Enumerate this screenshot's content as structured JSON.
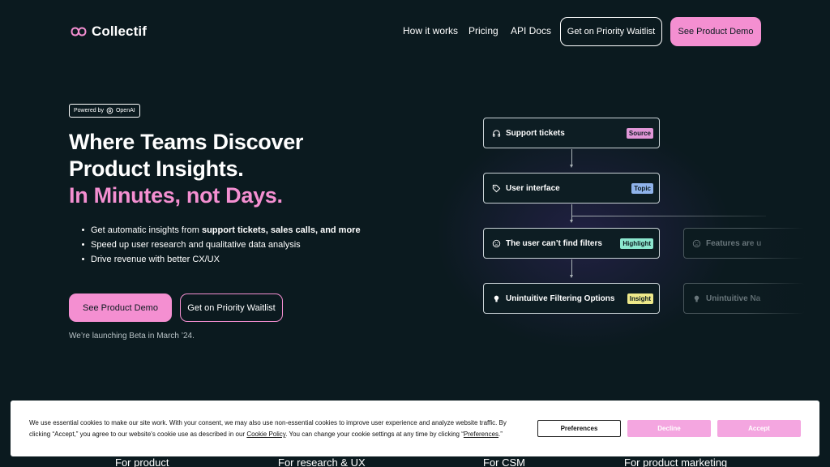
{
  "nav": {
    "logo_text": "Collectif",
    "links": [
      "How it works",
      "Pricing",
      "API Docs"
    ],
    "waitlist_label": "Get on Priority Waitlist",
    "demo_label": "See Product Demo"
  },
  "hero": {
    "badge_prefix": "Powered by",
    "badge_brand": "OpenAI",
    "title_line1": "Where Teams Discover",
    "title_line2": "Product Insights.",
    "title_line3": "In Minutes, not Days.",
    "bullet1_plain": "Get automatic insights from ",
    "bullet1_bold": "support tickets, sales calls, and more",
    "bullet2": "Speed up user research and qualitative data analysis",
    "bullet3": "Drive revenue with better CX/UX",
    "demo_label": "See Product Demo",
    "waitlist_label": "Get on Priority Waitlist",
    "launch_note": "We’re launching Beta in March ’24."
  },
  "flow": {
    "cards": [
      {
        "label": "Support tickets",
        "tag": "Source",
        "icon": "headphones-icon"
      },
      {
        "label": "User interface",
        "tag": "Topic",
        "icon": "tag-icon"
      },
      {
        "label": "The user can’t find filters",
        "tag": "Highlight",
        "icon": "face-icon"
      },
      {
        "label": "Unintuitive Filtering Options",
        "tag": "Insight",
        "icon": "bulb-icon"
      }
    ],
    "faded_cards": [
      {
        "label": "Features are u",
        "icon": "face-icon"
      },
      {
        "label": "Unintuitive Na",
        "icon": "bulb-icon"
      }
    ]
  },
  "bottom_peek": [
    "For product",
    "For research & UX",
    "For CSM",
    "For product marketing"
  ],
  "cookie": {
    "text_line1": "We use essential cookies to make our site work. With your consent, we may also use non-essential cookies to improve user experience and analyze website traffic. By",
    "text_line2_a": "clicking “Accept,” you agree to our website's cookie use as described in our ",
    "policy_link": "Cookie Policy",
    "text_line2_b": ". You can change your cookie settings at any time by clicking “",
    "prefs_link": "Preferences",
    "text_line2_c": ".”",
    "preferences_label": "Preferences",
    "decline_label": "Decline",
    "accept_label": "Accept"
  },
  "colors": {
    "background": "#0b1a1f",
    "accent_pink": "#f48fd1",
    "tag_source": "#e197d8",
    "tag_topic": "#8fb3ea",
    "tag_highlight": "#8ce7cf",
    "tag_insight": "#eee98a"
  }
}
